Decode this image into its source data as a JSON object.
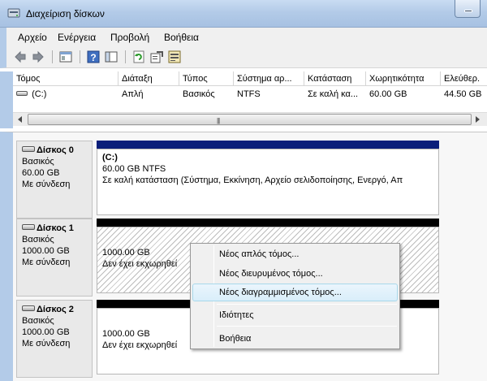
{
  "window": {
    "title": "Διαχείριση δίσκων"
  },
  "menu": [
    "Αρχείο",
    "Ενέργεια",
    "Προβολή",
    "Βοήθεια"
  ],
  "toolbar": {
    "icons": [
      "back-icon",
      "forward-icon",
      "properties-pane-icon",
      "help-icon",
      "show-hide-icon",
      "refresh-icon",
      "properties-icon",
      "settings-icon"
    ]
  },
  "volumes": {
    "columns": [
      "Τόμος",
      "Διάταξη",
      "Τύπος",
      "Σύστημα αρ...",
      "Κατάσταση",
      "Χωρητικότητα",
      "Ελεύθερ."
    ],
    "rows": [
      {
        "volume": "(C:)",
        "layout": "Απλή",
        "type": "Βασικός",
        "fs": "NTFS",
        "status": "Σε καλή κα...",
        "capacity": "60.00 GB",
        "free": "44.50 GB"
      }
    ]
  },
  "disks": [
    {
      "name": "Δίσκος 0",
      "type": "Βασικός",
      "size": "60.00 GB",
      "status": "Με σύνδεση",
      "partition": {
        "label": "(C:)",
        "size": "60.00 GB NTFS",
        "status": "Σε καλή κατάσταση (Σύστημα, Εκκίνηση, Αρχείο σελιδοποίησης, Ενεργό, Απ"
      },
      "bar_color": "#0a1e7a"
    },
    {
      "name": "Δίσκος 1",
      "type": "Βασικός",
      "size": "1000.00 GB",
      "status": "Με σύνδεση",
      "partition": {
        "size": "1000.00 GB",
        "status": "Δεν έχει εκχωρηθεί"
      },
      "bar_color": "#000000"
    },
    {
      "name": "Δίσκος 2",
      "type": "Βασικός",
      "size": "1000.00 GB",
      "status": "Με σύνδεση",
      "partition": {
        "size": "1000.00 GB",
        "status": "Δεν έχει εκχωρηθεί"
      },
      "bar_color": "#000000"
    }
  ],
  "context_menu": {
    "items": [
      "Νέος απλός τόμος...",
      "Νέος διευρυμένος τόμος...",
      "Νέος διαγραμμισμένος τόμος...",
      "Ιδιότητες",
      "Βοήθεια"
    ],
    "hovered": "Νέος διαγραμμισμένος τόμος..."
  },
  "colors": {
    "titlebar": "#b3cbe8",
    "primary_partition": "#0a1e7a",
    "unallocated": "#000000",
    "menu_hover": "#d9eefa"
  }
}
